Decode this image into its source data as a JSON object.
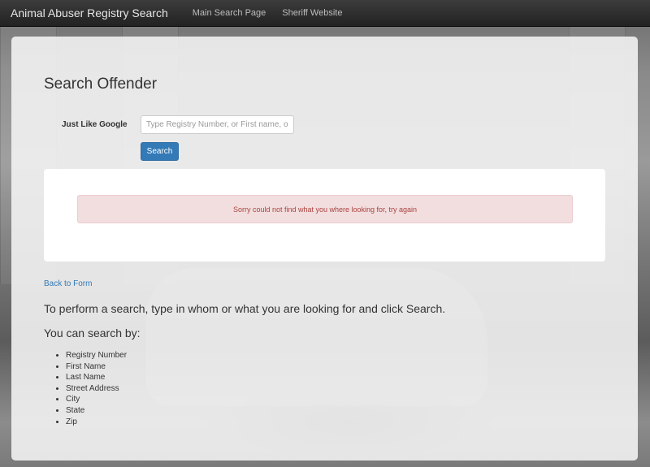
{
  "navbar": {
    "brand": "Animal Abuser Registry Search",
    "links": [
      {
        "label": "Main Search Page"
      },
      {
        "label": "Sheriff Website"
      }
    ]
  },
  "main": {
    "title": "Search Offender",
    "search": {
      "label": "Just Like Google",
      "placeholder": "Type Registry Number, or First name, or Last Name, or Street Address",
      "value": "",
      "button_label": "Search"
    },
    "alert": {
      "message": "Sorry could not find what you where looking for, try again"
    },
    "back_link": "Back to Form",
    "instructions": "To perform a search, type in whom or what you are looking for and click Search.",
    "search_by_heading": "You can search by:",
    "criteria": [
      "Registry Number",
      "First Name",
      "Last Name",
      "Street Address",
      "City",
      "State",
      "Zip"
    ]
  }
}
